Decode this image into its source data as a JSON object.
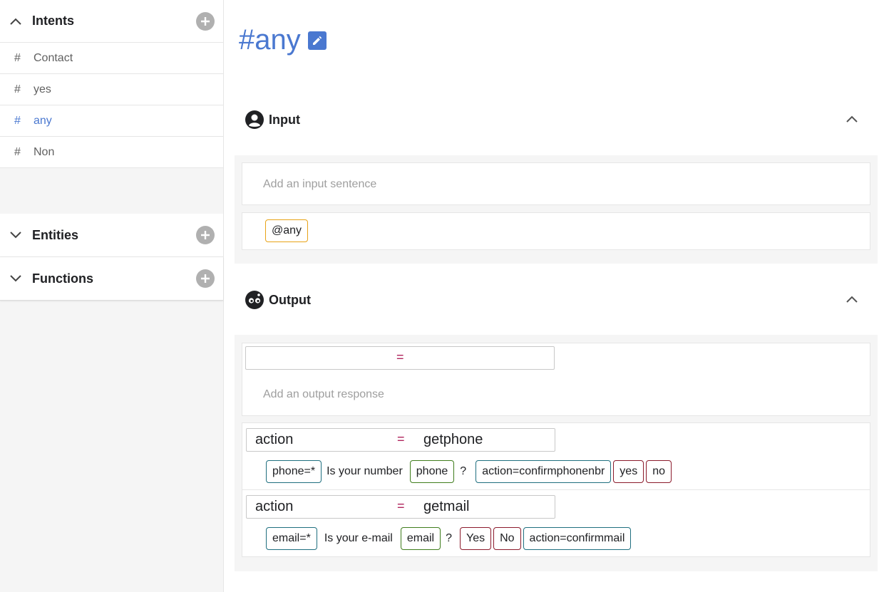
{
  "sidebar": {
    "intents": {
      "title": "Intents",
      "items": [
        {
          "hash": "#",
          "label": "Contact"
        },
        {
          "hash": "#",
          "label": "yes"
        },
        {
          "hash": "#",
          "label": "any"
        },
        {
          "hash": "#",
          "label": "Non"
        }
      ]
    },
    "entities": {
      "title": "Entities"
    },
    "functions": {
      "title": "Functions"
    }
  },
  "main": {
    "title": "#any",
    "input": {
      "title": "Input",
      "placeholder": "Add an input sentence",
      "entity_chip": "@any"
    },
    "output": {
      "title": "Output",
      "empty_condition": {
        "key": "",
        "eq": "=",
        "value": ""
      },
      "placeholder": "Add an output response",
      "responses": [
        {
          "condition": {
            "key": "action",
            "eq": "=",
            "value": "getphone"
          },
          "tokens": [
            {
              "type": "teal",
              "text": "phone=*"
            },
            {
              "type": "plain",
              "text": "Is your number"
            },
            {
              "type": "green",
              "text": "phone"
            },
            {
              "type": "plain",
              "text": "?"
            },
            {
              "type": "teal",
              "text": "action=confirmphonenbr"
            },
            {
              "type": "red",
              "text": "yes"
            },
            {
              "type": "red",
              "text": "no"
            }
          ]
        },
        {
          "condition": {
            "key": "action",
            "eq": "=",
            "value": "getmail"
          },
          "tokens": [
            {
              "type": "teal",
              "text": "email=*"
            },
            {
              "type": "plain",
              "text": "Is your e-mail"
            },
            {
              "type": "green",
              "text": "email"
            },
            {
              "type": "plain",
              "text": "?"
            },
            {
              "type": "red",
              "text": "Yes"
            },
            {
              "type": "red",
              "text": "No"
            },
            {
              "type": "teal",
              "text": "action=confirmmail"
            }
          ]
        }
      ]
    }
  },
  "colors": {
    "accent": "#4a78d0",
    "equals": "#b0245c",
    "chip_teal": "#1f6f7f",
    "chip_green": "#3f7d1c",
    "chip_red": "#8b1a2b",
    "chip_yellow": "#e8a317"
  },
  "icons": {
    "chevron_up": "chevron-up-icon",
    "chevron_down": "chevron-down-icon",
    "plus": "plus-circle-icon",
    "edit": "pencil-icon",
    "user": "user-circle-icon",
    "bot": "bot-icon"
  }
}
